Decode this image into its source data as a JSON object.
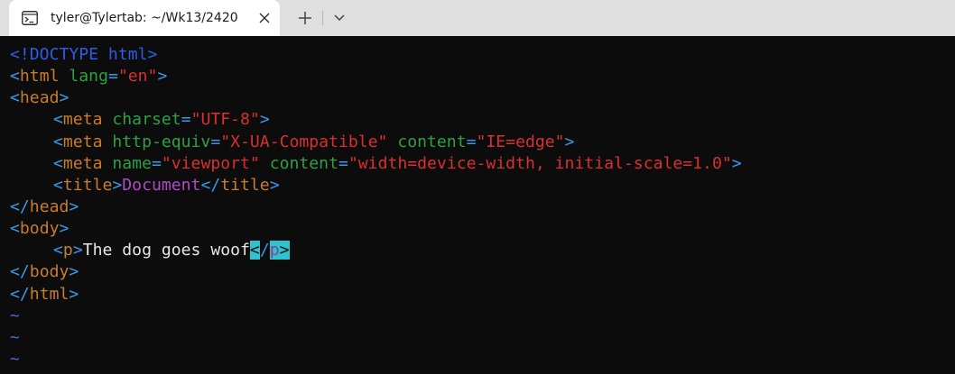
{
  "tab": {
    "title": "tyler@Tylertab: ~/Wk13/2420",
    "icon": "terminal-icon",
    "close_icon": "close-icon",
    "new_tab_icon": "plus-icon",
    "dropdown_icon": "chevron-down-icon"
  },
  "colors": {
    "doctype": "#2f5be6",
    "tag_name": "#c97c2c",
    "bracket": "#3d97e8",
    "attribute": "#2ea043",
    "value": "#d9302f",
    "title_text": "#b048c8",
    "cursor": "#2ec4cf"
  },
  "code": {
    "doctype": "<!DOCTYPE html>",
    "html_tag": "html",
    "lang_attr": "lang",
    "lang_val": "\"en\"",
    "head_tag": "head",
    "meta_tag": "meta",
    "charset_attr": "charset",
    "charset_val": "\"UTF-8\"",
    "http_equiv_attr": "http-equiv",
    "http_equiv_val": "\"X-UA-Compatible\"",
    "content_attr": "content",
    "content_val_1": "\"IE=edge\"",
    "name_attr": "name",
    "name_val": "\"viewport\"",
    "content_val_2": "\"width=device-width, initial-scale=1.0\"",
    "title_tag": "title",
    "title_text": "Document",
    "body_tag": "body",
    "p_tag": "p",
    "p_text": "The dog goes woof",
    "tilde": "~"
  }
}
